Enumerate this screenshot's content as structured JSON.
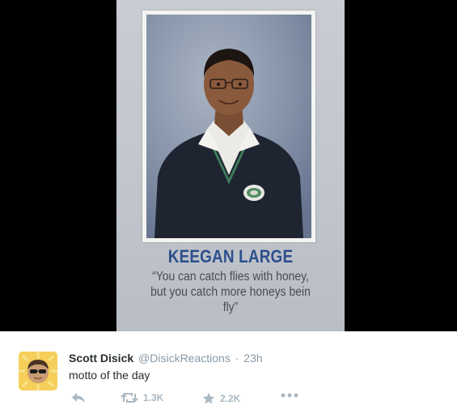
{
  "media": {
    "student_name": "KEEGAN LARGE",
    "quote_lines": [
      "“You can catch flies with honey,",
      "but you catch more honeys bein",
      "fly”"
    ]
  },
  "tweet": {
    "display_name": "Scott Disick",
    "handle": "@DisickReactions",
    "separator": "·",
    "timestamp": "23h",
    "text": "motto of the day",
    "actions": {
      "reply_icon": "reply-icon",
      "retweet_icon": "retweet-icon",
      "retweet_count": "1.3K",
      "favorite_icon": "star-icon",
      "favorite_count": "2.2K",
      "more_icon": "more-dots-icon"
    }
  },
  "colors": {
    "name_blue": "#2c4f8c",
    "action_gray": "#aab8c2",
    "meta_gray": "#8899a6",
    "text_dark": "#292f33"
  }
}
